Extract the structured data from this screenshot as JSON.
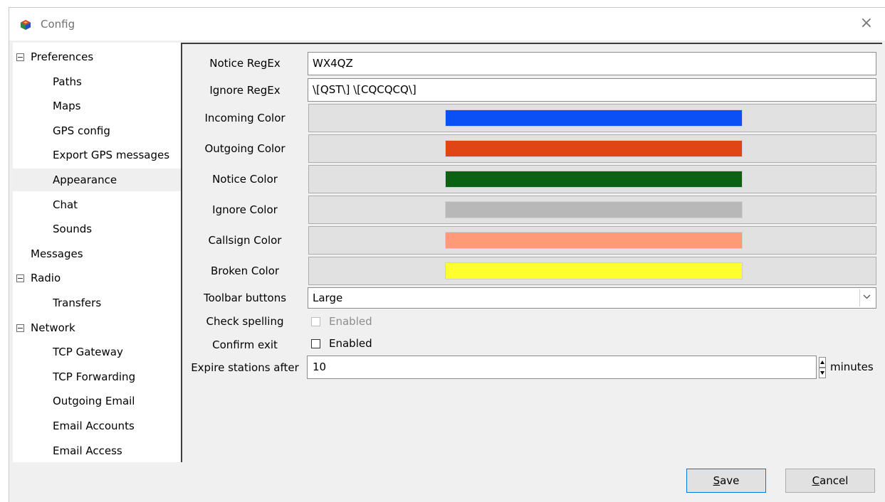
{
  "window": {
    "title": "Config",
    "close_glyph": "×"
  },
  "tree": [
    {
      "label": "Preferences",
      "level": 0,
      "expander": true,
      "selected": false
    },
    {
      "label": "Paths",
      "level": 1,
      "expander": false,
      "selected": false
    },
    {
      "label": "Maps",
      "level": 1,
      "expander": false,
      "selected": false
    },
    {
      "label": "GPS config",
      "level": 1,
      "expander": false,
      "selected": false
    },
    {
      "label": "Export GPS messages",
      "level": 1,
      "expander": false,
      "selected": false
    },
    {
      "label": "Appearance",
      "level": 1,
      "expander": false,
      "selected": true
    },
    {
      "label": "Chat",
      "level": 1,
      "expander": false,
      "selected": false
    },
    {
      "label": "Sounds",
      "level": 1,
      "expander": false,
      "selected": false
    },
    {
      "label": "Messages",
      "level": 0,
      "expander": false,
      "selected": false
    },
    {
      "label": "Radio",
      "level": 0,
      "expander": true,
      "selected": false
    },
    {
      "label": "Transfers",
      "level": 1,
      "expander": false,
      "selected": false
    },
    {
      "label": "Network",
      "level": 0,
      "expander": true,
      "selected": false
    },
    {
      "label": "TCP Gateway",
      "level": 1,
      "expander": false,
      "selected": false
    },
    {
      "label": "TCP Forwarding",
      "level": 1,
      "expander": false,
      "selected": false
    },
    {
      "label": "Outgoing Email",
      "level": 1,
      "expander": false,
      "selected": false
    },
    {
      "label": "Email Accounts",
      "level": 1,
      "expander": false,
      "selected": false
    },
    {
      "label": "Email Access",
      "level": 1,
      "expander": false,
      "selected": false
    }
  ],
  "appearance": {
    "notice_regex": {
      "label": "Notice RegEx",
      "value": "WX4QZ"
    },
    "ignore_regex": {
      "label": "Ignore RegEx",
      "value": "\\[QST\\] \\[CQCQCQ\\]"
    },
    "colors": [
      {
        "label": "Incoming Color",
        "color": "#0a50f5"
      },
      {
        "label": "Outgoing Color",
        "color": "#e04515"
      },
      {
        "label": "Notice Color",
        "color": "#0b6215"
      },
      {
        "label": "Ignore Color",
        "color": "#b8b8b8"
      },
      {
        "label": "Callsign Color",
        "color": "#ff9a79"
      },
      {
        "label": "Broken Color",
        "color": "#ffff2e"
      }
    ],
    "toolbar_buttons": {
      "label": "Toolbar buttons",
      "value": "Large"
    },
    "check_spelling": {
      "label": "Check spelling",
      "option": "Enabled",
      "checked": false,
      "disabled": true
    },
    "confirm_exit": {
      "label": "Confirm exit",
      "option": "Enabled",
      "checked": false,
      "disabled": false
    },
    "expire_stations": {
      "label": "Expire stations after",
      "value": "10",
      "unit": "minutes"
    }
  },
  "buttons": {
    "save": {
      "mnemonic": "S",
      "rest": "ave"
    },
    "cancel": {
      "mnemonic": "C",
      "rest": "ancel"
    }
  }
}
